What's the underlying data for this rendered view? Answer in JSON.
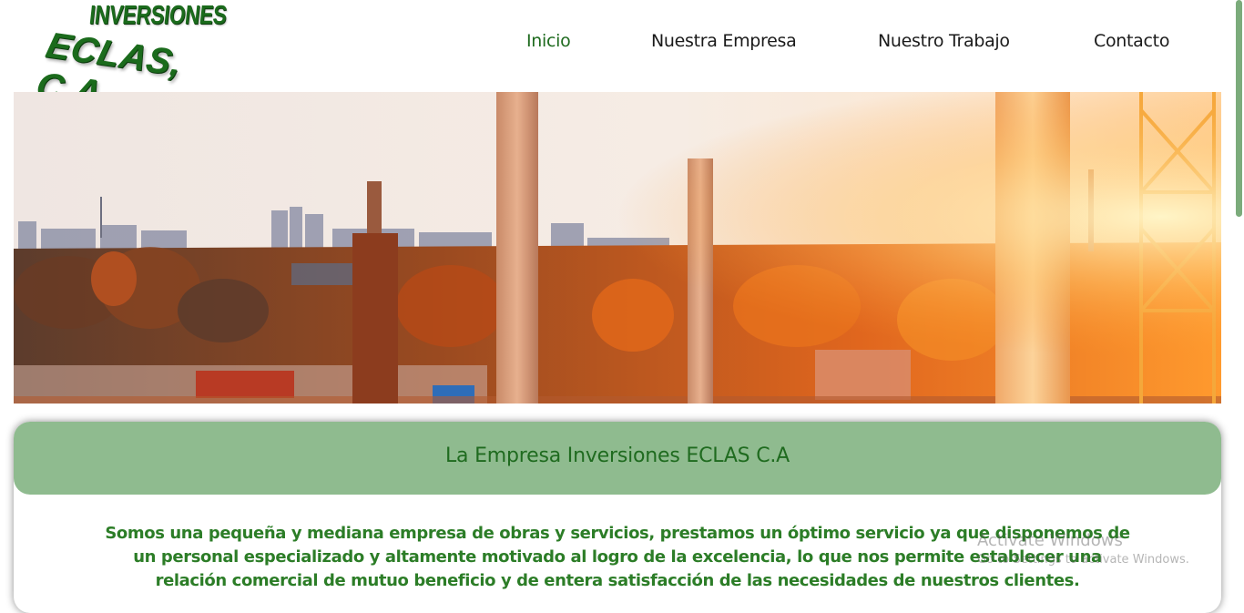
{
  "brand": {
    "line1": "INVERSIONES",
    "line2": "ECLAS, C.A.",
    "color": "#1b6b1c"
  },
  "nav": {
    "items": [
      {
        "label": "Inicio",
        "active": true
      },
      {
        "label": "Nuestra Empresa",
        "active": false
      },
      {
        "label": "Nuestro Trabajo",
        "active": false
      },
      {
        "label": "Contacto",
        "active": false
      }
    ],
    "active_color": "#1f6b1f"
  },
  "hero": {
    "alt": "construction site at sunset"
  },
  "intro": {
    "title": "La Empresa Inversiones ECLAS C.A",
    "body": "Somos una pequeña y mediana empresa de obras y servicios, prestamos un óptimo servicio ya que disponemos de un personal especializado y altamente motivado al logro de la excelencia, lo que nos permite establecer una relación comercial de mutuo beneficio y de entera satisfacción de las necesidades de nuestros clientes.",
    "header_color": "#8fbb8f",
    "text_color": "#2c7d27"
  },
  "watermark": {
    "line1": "Activate Windows",
    "line2": "Go to Settings to activate Windows."
  },
  "scrollbar": {
    "thumb_color": "#7bab7b"
  }
}
